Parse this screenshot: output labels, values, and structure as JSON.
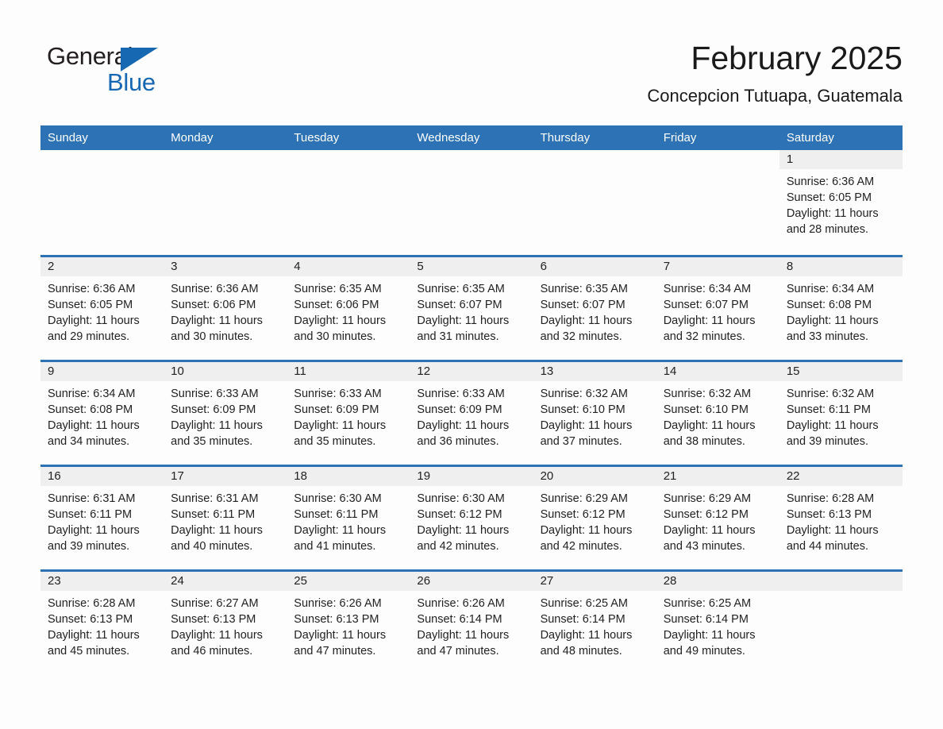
{
  "brand": {
    "name_part1": "General",
    "name_part2": "Blue",
    "accent_color": "#1668b3"
  },
  "header": {
    "title": "February 2025",
    "location": "Concepcion Tutuapa, Guatemala",
    "header_bg_color": "#2c72b4",
    "daynum_bg_color": "#efefef"
  },
  "weekday_headers": [
    "Sunday",
    "Monday",
    "Tuesday",
    "Wednesday",
    "Thursday",
    "Friday",
    "Saturday"
  ],
  "labels": {
    "sunrise_prefix": "Sunrise: ",
    "sunset_prefix": "Sunset: ",
    "daylight_prefix": "Daylight: "
  },
  "weeks": [
    [
      {
        "blank": true
      },
      {
        "blank": true
      },
      {
        "blank": true
      },
      {
        "blank": true
      },
      {
        "blank": true
      },
      {
        "blank": true
      },
      {
        "day": "1",
        "sunrise": "Sunrise: 6:36 AM",
        "sunset": "Sunset: 6:05 PM",
        "daylight": "Daylight: 11 hours and 28 minutes."
      }
    ],
    [
      {
        "day": "2",
        "sunrise": "Sunrise: 6:36 AM",
        "sunset": "Sunset: 6:05 PM",
        "daylight": "Daylight: 11 hours and 29 minutes."
      },
      {
        "day": "3",
        "sunrise": "Sunrise: 6:36 AM",
        "sunset": "Sunset: 6:06 PM",
        "daylight": "Daylight: 11 hours and 30 minutes."
      },
      {
        "day": "4",
        "sunrise": "Sunrise: 6:35 AM",
        "sunset": "Sunset: 6:06 PM",
        "daylight": "Daylight: 11 hours and 30 minutes."
      },
      {
        "day": "5",
        "sunrise": "Sunrise: 6:35 AM",
        "sunset": "Sunset: 6:07 PM",
        "daylight": "Daylight: 11 hours and 31 minutes."
      },
      {
        "day": "6",
        "sunrise": "Sunrise: 6:35 AM",
        "sunset": "Sunset: 6:07 PM",
        "daylight": "Daylight: 11 hours and 32 minutes."
      },
      {
        "day": "7",
        "sunrise": "Sunrise: 6:34 AM",
        "sunset": "Sunset: 6:07 PM",
        "daylight": "Daylight: 11 hours and 32 minutes."
      },
      {
        "day": "8",
        "sunrise": "Sunrise: 6:34 AM",
        "sunset": "Sunset: 6:08 PM",
        "daylight": "Daylight: 11 hours and 33 minutes."
      }
    ],
    [
      {
        "day": "9",
        "sunrise": "Sunrise: 6:34 AM",
        "sunset": "Sunset: 6:08 PM",
        "daylight": "Daylight: 11 hours and 34 minutes."
      },
      {
        "day": "10",
        "sunrise": "Sunrise: 6:33 AM",
        "sunset": "Sunset: 6:09 PM",
        "daylight": "Daylight: 11 hours and 35 minutes."
      },
      {
        "day": "11",
        "sunrise": "Sunrise: 6:33 AM",
        "sunset": "Sunset: 6:09 PM",
        "daylight": "Daylight: 11 hours and 35 minutes."
      },
      {
        "day": "12",
        "sunrise": "Sunrise: 6:33 AM",
        "sunset": "Sunset: 6:09 PM",
        "daylight": "Daylight: 11 hours and 36 minutes."
      },
      {
        "day": "13",
        "sunrise": "Sunrise: 6:32 AM",
        "sunset": "Sunset: 6:10 PM",
        "daylight": "Daylight: 11 hours and 37 minutes."
      },
      {
        "day": "14",
        "sunrise": "Sunrise: 6:32 AM",
        "sunset": "Sunset: 6:10 PM",
        "daylight": "Daylight: 11 hours and 38 minutes."
      },
      {
        "day": "15",
        "sunrise": "Sunrise: 6:32 AM",
        "sunset": "Sunset: 6:11 PM",
        "daylight": "Daylight: 11 hours and 39 minutes."
      }
    ],
    [
      {
        "day": "16",
        "sunrise": "Sunrise: 6:31 AM",
        "sunset": "Sunset: 6:11 PM",
        "daylight": "Daylight: 11 hours and 39 minutes."
      },
      {
        "day": "17",
        "sunrise": "Sunrise: 6:31 AM",
        "sunset": "Sunset: 6:11 PM",
        "daylight": "Daylight: 11 hours and 40 minutes."
      },
      {
        "day": "18",
        "sunrise": "Sunrise: 6:30 AM",
        "sunset": "Sunset: 6:11 PM",
        "daylight": "Daylight: 11 hours and 41 minutes."
      },
      {
        "day": "19",
        "sunrise": "Sunrise: 6:30 AM",
        "sunset": "Sunset: 6:12 PM",
        "daylight": "Daylight: 11 hours and 42 minutes."
      },
      {
        "day": "20",
        "sunrise": "Sunrise: 6:29 AM",
        "sunset": "Sunset: 6:12 PM",
        "daylight": "Daylight: 11 hours and 42 minutes."
      },
      {
        "day": "21",
        "sunrise": "Sunrise: 6:29 AM",
        "sunset": "Sunset: 6:12 PM",
        "daylight": "Daylight: 11 hours and 43 minutes."
      },
      {
        "day": "22",
        "sunrise": "Sunrise: 6:28 AM",
        "sunset": "Sunset: 6:13 PM",
        "daylight": "Daylight: 11 hours and 44 minutes."
      }
    ],
    [
      {
        "day": "23",
        "sunrise": "Sunrise: 6:28 AM",
        "sunset": "Sunset: 6:13 PM",
        "daylight": "Daylight: 11 hours and 45 minutes."
      },
      {
        "day": "24",
        "sunrise": "Sunrise: 6:27 AM",
        "sunset": "Sunset: 6:13 PM",
        "daylight": "Daylight: 11 hours and 46 minutes."
      },
      {
        "day": "25",
        "sunrise": "Sunrise: 6:26 AM",
        "sunset": "Sunset: 6:13 PM",
        "daylight": "Daylight: 11 hours and 47 minutes."
      },
      {
        "day": "26",
        "sunrise": "Sunrise: 6:26 AM",
        "sunset": "Sunset: 6:14 PM",
        "daylight": "Daylight: 11 hours and 47 minutes."
      },
      {
        "day": "27",
        "sunrise": "Sunrise: 6:25 AM",
        "sunset": "Sunset: 6:14 PM",
        "daylight": "Daylight: 11 hours and 48 minutes."
      },
      {
        "day": "28",
        "sunrise": "Sunrise: 6:25 AM",
        "sunset": "Sunset: 6:14 PM",
        "daylight": "Daylight: 11 hours and 49 minutes."
      },
      {
        "empty": true
      }
    ]
  ]
}
